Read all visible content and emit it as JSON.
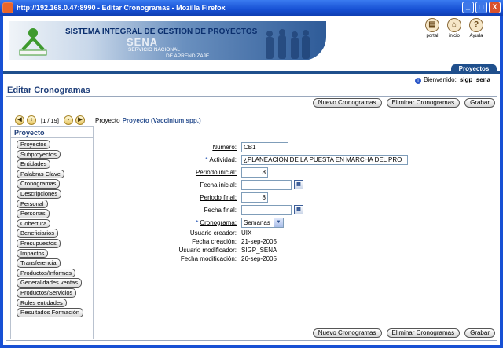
{
  "window": {
    "title": "http://192.168.0.47:8990 - Editar Cronogramas - Mozilla Firefox",
    "btn_min": "_",
    "btn_max": "□",
    "btn_close": "X"
  },
  "header": {
    "system_title": "SISTEMA INTEGRAL DE GESTION DE PROYECTOS",
    "brand": "SENA",
    "brand_sub1": "SERVICIO NACIONAL",
    "brand_sub2": "DE APRENDIZAJE",
    "icons": [
      {
        "label": "portal",
        "icon": "portal-icon"
      },
      {
        "label": "inicio",
        "icon": "home-icon"
      },
      {
        "label": "Ayuda",
        "icon": "help-icon"
      }
    ],
    "tab": "Proyectos",
    "welcome_label": "Bienvenido:",
    "welcome_user": "sigp_sena"
  },
  "page": {
    "title": "Editar Cronogramas"
  },
  "toolbar": {
    "new_label": "Nuevo Cronogramas",
    "delete_label": "Eliminar Cronogramas",
    "save_label": "Grabar"
  },
  "pager": {
    "count": "[1 / 19]",
    "project_label": "Proyecto",
    "project_name": "Proyecto (Vaccinium spp.)"
  },
  "sidebar": {
    "header": "Proyecto",
    "items": [
      "Proyectos",
      "Subproyectos",
      "Entidades",
      "Palabras Clave",
      "Cronogramas",
      "Descripciones",
      "Personal",
      "Personas",
      "Cobertura",
      "Beneficiarios",
      "Presupuestos",
      "Impactos",
      "Transferencia",
      "Productos/Informes",
      "Generalidades ventas",
      "Productos/Servicios",
      "Roles entidades",
      "Resultados Formación"
    ]
  },
  "form": {
    "numero_label": "Número:",
    "numero_value": "CB1",
    "actividad_label": "Actividad:",
    "actividad_value": "¿PLANEACIÓN DE LA PUESTA EN MARCHA DEL PRO",
    "periodo_inicial_label": "Periodo inicial:",
    "periodo_inicial_value": "8",
    "fecha_inicial_label": "Fecha inicial:",
    "fecha_inicial_value": "",
    "periodo_final_label": "Periodo final:",
    "periodo_final_value": "8",
    "fecha_final_label": "Fecha final:",
    "fecha_final_value": "",
    "cronograma_label": "Cronograma:",
    "cronograma_value": "Semanas",
    "usuario_creador_label": "Usuario creador:",
    "usuario_creador_value": "UIX",
    "fecha_creacion_label": "Fecha creación:",
    "fecha_creacion_value": "21-sep-2005",
    "usuario_modificador_label": "Usuario modificador:",
    "usuario_modificador_value": "SIGP_SENA",
    "fecha_modificacion_label": "Fecha modificación:",
    "fecha_modificacion_value": "26-sep-2005",
    "required_mark": "*"
  }
}
